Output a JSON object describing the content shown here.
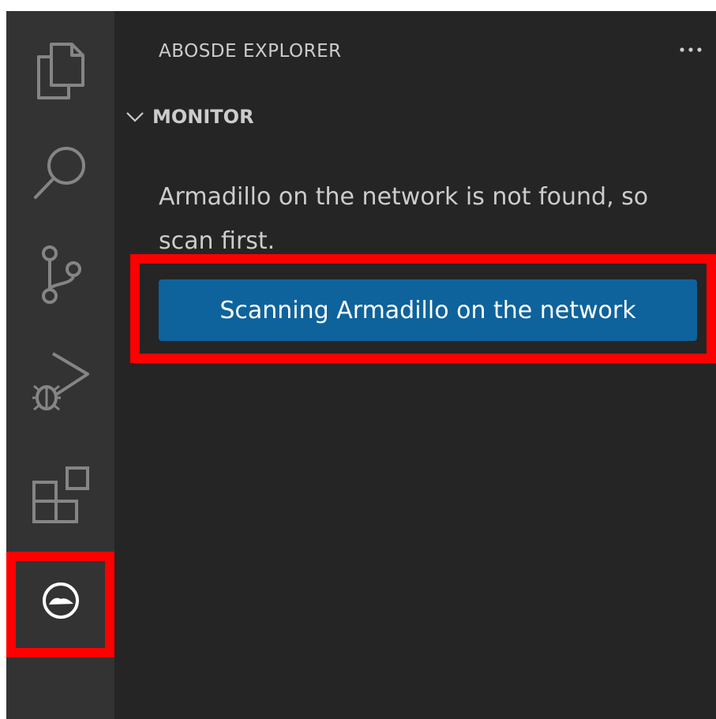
{
  "activity_bar": {
    "items": [
      {
        "name": "explorer",
        "icon": "files-icon"
      },
      {
        "name": "search",
        "icon": "search-icon"
      },
      {
        "name": "source-control",
        "icon": "source-control-icon"
      },
      {
        "name": "run-and-debug",
        "icon": "run-debug-icon"
      },
      {
        "name": "extensions",
        "icon": "extensions-icon"
      },
      {
        "name": "abosde",
        "icon": "abosde-icon",
        "active": true
      }
    ]
  },
  "sidebar": {
    "title": "ABOSDE EXPLORER",
    "more_actions": "···",
    "section": {
      "title": "MONITOR",
      "expanded": true,
      "message": "Armadillo on the network is not found, so scan first.",
      "button_label": "Scanning Armadillo on the network"
    }
  },
  "colors": {
    "activity_bar": "#333333",
    "sidebar": "#252526",
    "button": "#0e639c",
    "text": "#cccccc",
    "highlight": "#ff0000"
  }
}
